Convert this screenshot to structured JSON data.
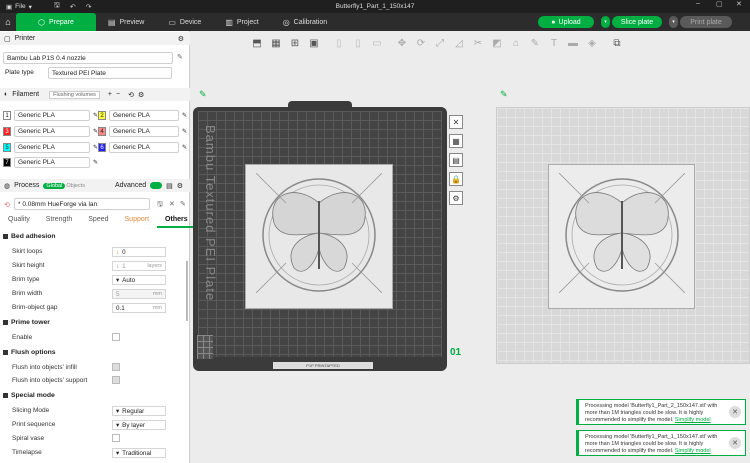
{
  "titlebar": {
    "file_label": "File",
    "document": "Butterfly1_Part_1_150x147"
  },
  "menu": {
    "tabs": [
      {
        "label": "Prepare"
      },
      {
        "label": "Preview"
      },
      {
        "label": "Device"
      },
      {
        "label": "Project"
      },
      {
        "label": "Calibration"
      }
    ],
    "upload_label": "Upload",
    "slice_label": "Slice plate",
    "print_label": "Print plate"
  },
  "printer": {
    "header": "Printer",
    "name": "Bambu Lab P1S 0.4 nozzle",
    "plate_type_label": "Plate type",
    "plate_type": "Textured PEI Plate"
  },
  "filament": {
    "header": "Filament",
    "flushing_label": "Flushing volumes",
    "items": [
      {
        "num": "1",
        "name": "Generic PLA",
        "color": "#ffffff"
      },
      {
        "num": "2",
        "name": "Generic PLA",
        "color": "#ffff33"
      },
      {
        "num": "3",
        "name": "Generic PLA",
        "color": "#ff2020"
      },
      {
        "num": "4",
        "name": "Generic PLA",
        "color": "#ff8888"
      },
      {
        "num": "5",
        "name": "Generic PLA",
        "color": "#00ffff"
      },
      {
        "num": "6",
        "name": "Generic PLA",
        "color": "#2020ff"
      },
      {
        "num": "7",
        "name": "Generic PLA",
        "color": "#000000"
      }
    ]
  },
  "process": {
    "header": "Process",
    "global_label": "Global",
    "objects_label": "Objects",
    "advanced_label": "Advanced",
    "profile": "* 0.08mm HueForge via lan"
  },
  "tabs": [
    "Quality",
    "Strength",
    "Speed",
    "Support",
    "Others"
  ],
  "bed_adhesion": {
    "title": "Bed adhesion",
    "skirt_loops_label": "Skirt loops",
    "skirt_loops": "0",
    "skirt_height_label": "Skirt height",
    "skirt_height": "1",
    "skirt_height_unit": "layers",
    "brim_type_label": "Brim type",
    "brim_type": "Auto",
    "brim_width_label": "Brim width",
    "brim_width": "5",
    "brim_width_unit": "mm",
    "brim_gap_label": "Brim-object gap",
    "brim_gap": "0.1",
    "brim_gap_unit": "mm"
  },
  "prime_tower": {
    "title": "Prime tower",
    "enable_label": "Enable"
  },
  "flush_options": {
    "title": "Flush options",
    "infill_label": "Flush into objects' infill",
    "support_label": "Flush into objects' support"
  },
  "special_mode": {
    "title": "Special mode",
    "slicing_mode_label": "Slicing Mode",
    "slicing_mode": "Regular",
    "print_seq_label": "Print sequence",
    "print_seq": "By layer",
    "spiral_label": "Spiral vase",
    "timelapse_label": "Timelapse",
    "timelapse": "Traditional"
  },
  "plate": {
    "label": "Bambu Textured PEI Plate",
    "number": "01",
    "footer_text": "P1P PRINTAPTED"
  },
  "notifications": [
    {
      "text": "Processing model 'Butterfly1_Part_2_150x147.stl' with more than 1M triangles could be slow. It is highly recommended to simplify the model.",
      "link": "Simplify model"
    },
    {
      "text": "Processing model 'Butterfly1_Part_1_150x147.stl' with more than 1M triangles could be slow. It is highly recommended to simplify the model.",
      "link": "Simplify model"
    }
  ]
}
